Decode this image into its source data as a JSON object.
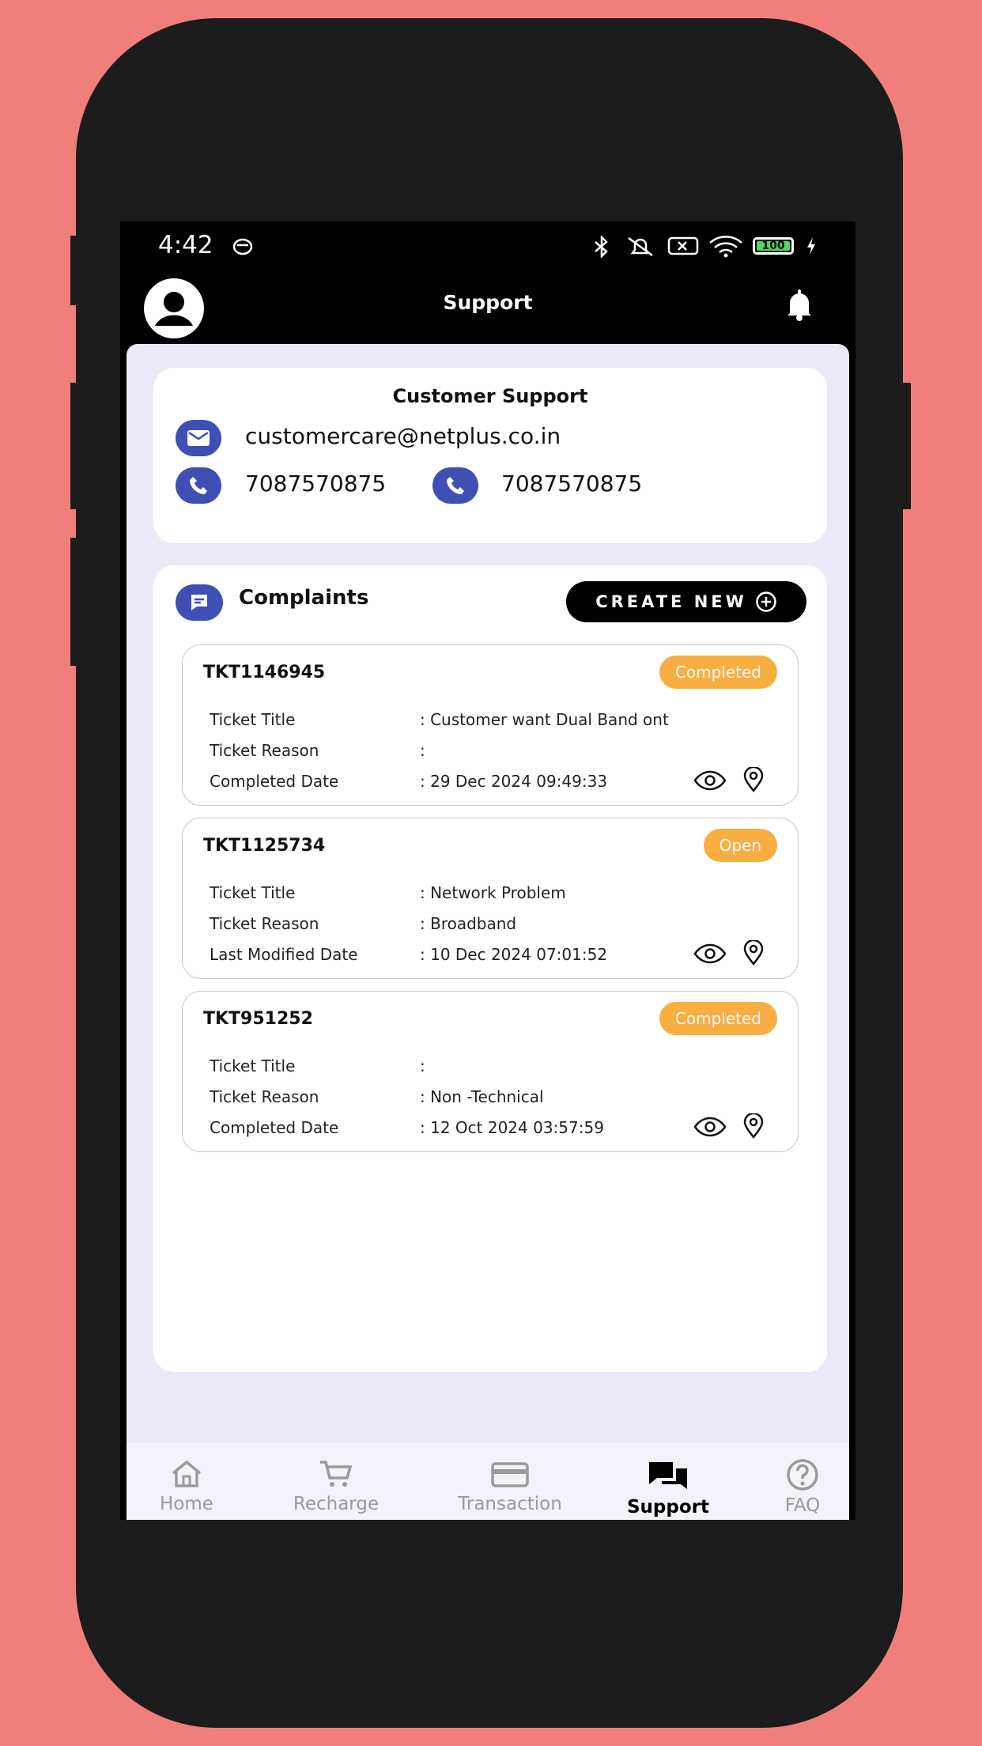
{
  "status_bar": {
    "time": "4:42",
    "battery": "100"
  },
  "app_bar": {
    "title": "Support"
  },
  "customer_support": {
    "title": "Customer Support",
    "email": "customercare@netplus.co.in",
    "phone1": "7087570875",
    "phone2": "7087570875"
  },
  "complaints": {
    "title": "Complaints",
    "create_label": "CREATE NEW",
    "tickets": [
      {
        "id": "TKT1146945",
        "status": "Completed",
        "rows": [
          {
            "label": "Ticket Title",
            "value": ": Customer want Dual Band ont"
          },
          {
            "label": "Ticket Reason",
            "value": ":"
          },
          {
            "label": "Completed Date",
            "value": ": 29 Dec 2024 09:49:33"
          }
        ]
      },
      {
        "id": "TKT1125734",
        "status": "Open",
        "rows": [
          {
            "label": "Ticket Title",
            "value": ": Network Problem"
          },
          {
            "label": "Ticket Reason",
            "value": ": Broadband"
          },
          {
            "label": "Last Modified Date",
            "value": ": 10 Dec 2024 07:01:52"
          }
        ]
      },
      {
        "id": "TKT951252",
        "status": "Completed",
        "rows": [
          {
            "label": "Ticket Title",
            "value": ":"
          },
          {
            "label": "Ticket Reason",
            "value": ": Non -Technical"
          },
          {
            "label": "Completed Date",
            "value": ": 12 Oct 2024 03:57:59"
          }
        ]
      }
    ]
  },
  "bottom_nav": {
    "items": [
      {
        "label": "Home",
        "icon": "home-icon"
      },
      {
        "label": "Recharge",
        "icon": "cart-icon"
      },
      {
        "label": "Transaction",
        "icon": "card-icon"
      },
      {
        "label": "Support",
        "icon": "chat-icon",
        "active": true
      },
      {
        "label": "FAQ",
        "icon": "help-icon"
      }
    ]
  },
  "colors": {
    "accent": "#3f4fb3",
    "badge": "#f9ae42",
    "background": "#f07f7c"
  }
}
